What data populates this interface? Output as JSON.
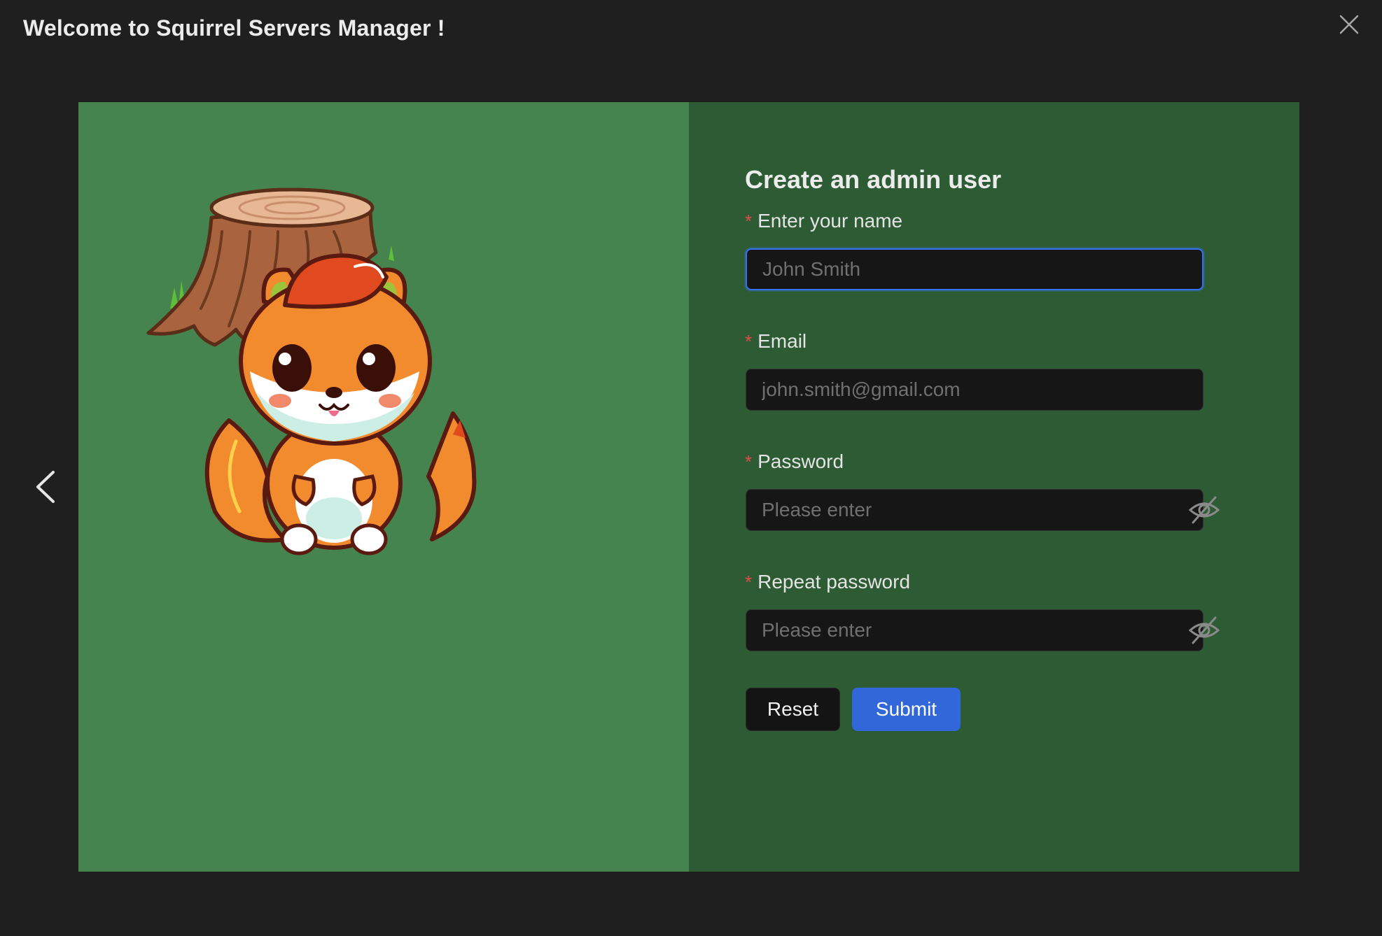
{
  "modal": {
    "title": "Welcome to Squirrel Servers Manager !",
    "close_icon": "close-icon",
    "prev_icon": "chevron-left-icon"
  },
  "form": {
    "title": "Create an admin user",
    "required_mark": "*",
    "fields": [
      {
        "label": "Enter your name",
        "value": "",
        "placeholder": "John Smith",
        "focused": true
      },
      {
        "label": "Email",
        "value": "",
        "placeholder": "john.smith@gmail.com"
      },
      {
        "label": "Password",
        "value": "",
        "placeholder": "Please enter",
        "icon": "eye-slash-icon"
      },
      {
        "label": "Repeat password",
        "value": "",
        "placeholder": "Please enter",
        "icon": "eye-slash-icon"
      }
    ],
    "reset_label": "Reset",
    "submit_label": "Submit"
  },
  "colors": {
    "background": "#1f1f1f",
    "left_panel": "#46844f",
    "right_panel": "#2d5b33",
    "primary": "#3167d8",
    "required": "#e04a4a"
  }
}
